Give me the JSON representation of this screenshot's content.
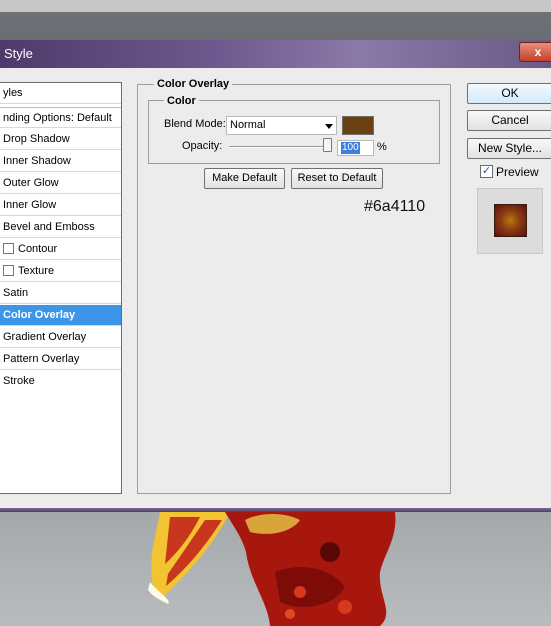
{
  "dialog": {
    "title": "Style",
    "close_glyph": "x",
    "list_header": "yles",
    "styles": [
      {
        "label": "nding Options: Default",
        "checkbox": false,
        "selected": false
      },
      {
        "label": "Drop Shadow",
        "checkbox": false,
        "selected": false
      },
      {
        "label": "Inner Shadow",
        "checkbox": false,
        "selected": false
      },
      {
        "label": "Outer Glow",
        "checkbox": false,
        "selected": false
      },
      {
        "label": "Inner Glow",
        "checkbox": false,
        "selected": false
      },
      {
        "label": "Bevel and Emboss",
        "checkbox": false,
        "selected": false
      },
      {
        "label": "Contour",
        "checkbox": true,
        "selected": false
      },
      {
        "label": "Texture",
        "checkbox": true,
        "selected": false
      },
      {
        "label": "Satin",
        "checkbox": false,
        "selected": false
      },
      {
        "label": "Color Overlay",
        "checkbox": false,
        "selected": true
      },
      {
        "label": "Gradient Overlay",
        "checkbox": false,
        "selected": false
      },
      {
        "label": "Pattern Overlay",
        "checkbox": false,
        "selected": false
      },
      {
        "label": "Stroke",
        "checkbox": false,
        "selected": false
      }
    ],
    "panel_title": "Color Overlay",
    "group_title": "Color",
    "blend_mode_label": "Blend Mode:",
    "blend_mode_value": "Normal",
    "overlay_color": "#6a4110",
    "opacity_label": "Opacity:",
    "opacity_value": "100",
    "opacity_unit": "%",
    "make_default": "Make Default",
    "reset_default": "Reset to Default",
    "hex_annotation": "#6a4110",
    "ok": "OK",
    "cancel": "Cancel",
    "new_style": "New Style...",
    "preview_label": "Preview",
    "preview_checked": true
  },
  "colors": {
    "selection": "#3d95e8",
    "titlebar": "#6f5a8f"
  }
}
